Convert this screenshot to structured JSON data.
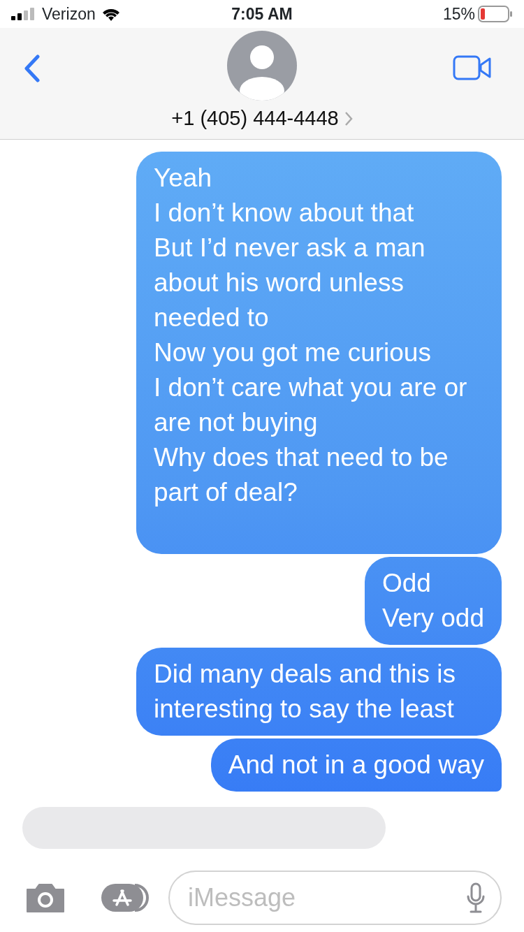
{
  "status_bar": {
    "carrier": "Verizon",
    "time": "7:05 AM",
    "battery": "15%"
  },
  "header": {
    "contact": "+1 (405) 444-4448"
  },
  "messages": [
    {
      "kind": "sent",
      "text": "Yeah\nI don’t know about that\nBut I’d never ask a man about his word unless needed to\nNow you got me curious\nI don’t care what you are or are not buying\nWhy does that need to be part of deal?\n",
      "tail": false
    },
    {
      "kind": "sent",
      "text": "Odd\nVery odd",
      "tail": false
    },
    {
      "kind": "sent",
      "text": "Did many deals and this is interesting to say the least",
      "tail": false
    },
    {
      "kind": "sent",
      "text": "And not in a good way",
      "tail": true
    },
    {
      "kind": "received"
    }
  ],
  "composer": {
    "placeholder": "iMessage"
  }
}
